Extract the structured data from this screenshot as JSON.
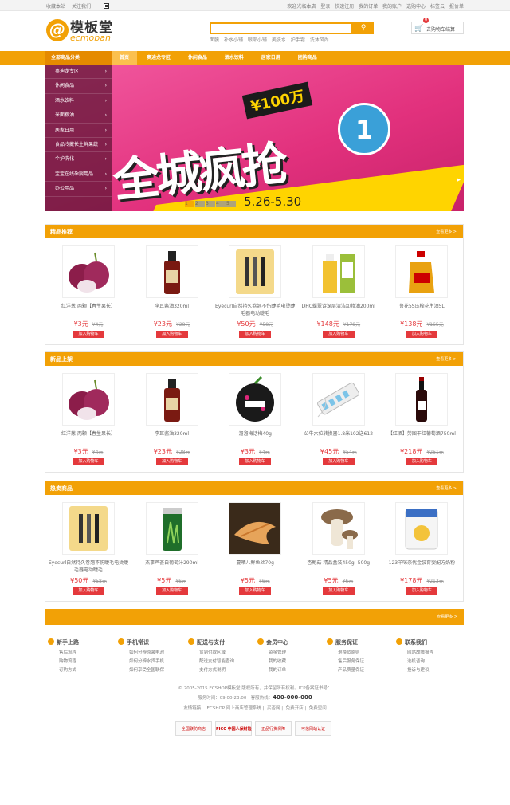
{
  "topbar": {
    "favorite": "收藏本站",
    "follow": "关注我们：",
    "welcome": "欢迎光临本店",
    "login": "登录",
    "register": "快速注册",
    "links": [
      "我的订单",
      "我的账户",
      "选购中心",
      "标签云",
      "报价单"
    ]
  },
  "logo": {
    "cn": "模板堂",
    "en": "ecmoban"
  },
  "search": {
    "placeholder": "",
    "button_icon": "search-icon"
  },
  "hotwords": [
    "面膜",
    "补水小铺",
    "眼部小铺",
    "美肤水",
    "护手霜",
    "洗沐风尚"
  ],
  "cart": {
    "label": "去购物车结算",
    "count": "0"
  },
  "nav": {
    "all_categories": "全部商品分类",
    "items": [
      "首页",
      "奥迪龙专区",
      "休闲食品",
      "酒水饮料",
      "居家日用",
      "团购商品"
    ]
  },
  "categories": [
    "奥迪龙专区",
    "休闲食品",
    "酒水饮料",
    "米面粮油",
    "居家日用",
    "食品冷藏长生鲜果蔬",
    "个护洗化",
    "宝宝在线孕婴用品",
    "办公用品"
  ],
  "banner": {
    "amount": "¥100万",
    "headline": "全城疯抢",
    "date": "5.26-5.30",
    "slides": [
      "1",
      "2",
      "3",
      "4",
      "5"
    ]
  },
  "sections": [
    {
      "title": "精品推荐",
      "more": "查看更多 >",
      "products": [
        {
          "name": "红洋葱 两颗【春生果长】",
          "price": "¥3元",
          "old": "¥4元",
          "add": "加入购物车",
          "img": "onion"
        },
        {
          "name": "李耳酱油320ml",
          "price": "¥23元",
          "old": "¥28元",
          "add": "加入购物车",
          "img": "soy"
        },
        {
          "name": "Eyecurl自然持久卷翘不伤睫毛电烫睫毛器电动睫毛",
          "price": "¥50元",
          "old": "¥58元",
          "add": "加入购物车",
          "img": "curler"
        },
        {
          "name": "DHC蝶翠诗深层清洁卸妆油200ml",
          "price": "¥148元",
          "old": "¥178元",
          "add": "加入购物车",
          "img": "oil"
        },
        {
          "name": "鲁花5S压榨花生油5L",
          "price": "¥138元",
          "old": "¥165元",
          "add": "加入购物车",
          "img": "peanut"
        }
      ]
    },
    {
      "title": "新品上架",
      "more": "查看更多 >",
      "products": [
        {
          "name": "红洋葱 两颗【春生果长】",
          "price": "¥3元",
          "old": "¥4元",
          "add": "加入购物车",
          "img": "onion"
        },
        {
          "name": "李耳酱油320ml",
          "price": "¥23元",
          "old": "¥28元",
          "add": "加入购物车",
          "img": "soy"
        },
        {
          "name": "溜溜梅话梅40g",
          "price": "¥3元",
          "old": "¥4元",
          "add": "加入购物车",
          "img": "plum"
        },
        {
          "name": "公牛六位转换器1.8米102送612",
          "price": "¥45元",
          "old": "¥54元",
          "add": "加入购物车",
          "img": "socket"
        },
        {
          "name": "【红酒】劳图干红葡萄酒750ml",
          "price": "¥218元",
          "old": "¥261元",
          "add": "加入购物车",
          "img": "wine"
        }
      ]
    },
    {
      "title": "热卖商品",
      "more": "查看更多 >",
      "products": [
        {
          "name": "Eyecurl自然持久卷翘不伤睫毛电烫睫毛器电动睫毛",
          "price": "¥50元",
          "old": "¥58元",
          "add": "加入购物车",
          "img": "curler"
        },
        {
          "name": "杰事芦荟白葡萄汁290ml",
          "price": "¥5元",
          "old": "¥6元",
          "add": "加入购物车",
          "img": "aloe"
        },
        {
          "name": "蔓晒八鲜鱼丝70g",
          "price": "¥5元",
          "old": "¥6元",
          "add": "加入购物车",
          "img": "fish"
        },
        {
          "name": "杏鲍菇 精品盒装450g -500g",
          "price": "¥5元",
          "old": "¥6元",
          "add": "加入购物车",
          "img": "mushroom"
        },
        {
          "name": "123羊咪奈优金装育婴配方奶粉",
          "price": "¥178元",
          "old": "¥213元",
          "add": "加入购物车",
          "img": "milk"
        }
      ]
    }
  ],
  "extra_more": "查看更多 >",
  "footer": {
    "columns": [
      {
        "title": "新手上路",
        "links": [
          "售后流程",
          "购物流程",
          "订购方式"
        ]
      },
      {
        "title": "手机常识",
        "links": [
          "如何分辨原装电池",
          "如何分辨水货手机",
          "如何享受全国联保"
        ]
      },
      {
        "title": "配送与支付",
        "links": [
          "货到付款区域",
          "配送支付智能查询",
          "支付方式说明"
        ]
      },
      {
        "title": "会员中心",
        "links": [
          "资金管理",
          "我的收藏",
          "我的订单"
        ]
      },
      {
        "title": "服务保证",
        "links": [
          "退换货原则",
          "售后服务保证",
          "产品质量保证"
        ]
      },
      {
        "title": "联系我们",
        "links": [
          "网站故障报告",
          "选机咨询",
          "投诉与建议"
        ]
      }
    ],
    "copyright": "© 2005-2015 ECSHOP模板堂 版权所有，并保留所有权利。ICP备案证书号：",
    "service_time": "服务时间：09:00-23:00",
    "hotline_label": "客服热线：",
    "hotline": "400-000-000",
    "friendly_links": [
      "友情链接：",
      "ECSHOP 网上商店管理系统",
      "买否网",
      "免费开店",
      "免费空间"
    ],
    "badges": [
      "全国联防商店",
      "PICC 中国人保财险",
      "正品行货保障",
      "可信网站认证"
    ]
  },
  "colors": {
    "accent": "#f2a106",
    "price": "#e4393c"
  }
}
